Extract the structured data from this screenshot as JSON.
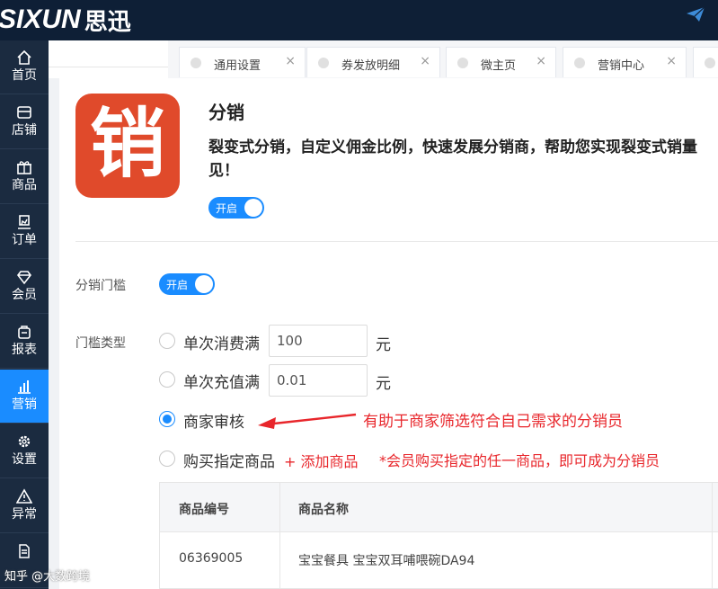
{
  "brand": {
    "en": "SIXUN",
    "cn": "思迅"
  },
  "sidebar": {
    "items": [
      {
        "label": "首页",
        "icon": "home-icon"
      },
      {
        "label": "店铺",
        "icon": "store-icon"
      },
      {
        "label": "商品",
        "icon": "gift-icon"
      },
      {
        "label": "订单",
        "icon": "order-icon"
      },
      {
        "label": "会员",
        "icon": "diamond-icon"
      },
      {
        "label": "报表",
        "icon": "report-icon"
      },
      {
        "label": "营销",
        "icon": "bar-chart-icon",
        "active": true
      },
      {
        "label": "设置",
        "icon": "gear-icon"
      },
      {
        "label": "异常",
        "icon": "warning-icon"
      },
      {
        "label": "",
        "icon": "document-icon"
      }
    ]
  },
  "tabs": [
    {
      "label": "通用设置",
      "close": "×"
    },
    {
      "label": "券发放明细",
      "close": "×"
    },
    {
      "label": "微主页",
      "close": "×"
    },
    {
      "label": "营销中心",
      "close": "×"
    }
  ],
  "feature": {
    "icon_char": "销",
    "title": "分销",
    "description_line1": "裂变式分销，自定义佣金比例，快速发展分销商，帮助您实现裂变式销量",
    "description_line2": "见！",
    "switch_label": "开启"
  },
  "form": {
    "threshold_label": "分销门槛",
    "threshold_switch": "开启",
    "type_label": "门槛类型",
    "options": [
      {
        "label": "单次消费满",
        "value": "100",
        "unit": "元",
        "checked": false
      },
      {
        "label": "单次充值满",
        "value": "0.01",
        "unit": "元",
        "checked": false
      },
      {
        "label": "商家审核",
        "checked": true
      },
      {
        "label": "购买指定商品",
        "checked": false
      }
    ],
    "add_product": "+ 添加商品"
  },
  "annotations": {
    "arrow_note": "有助于商家筛选符合自己需求的分销员",
    "product_note": "*会员购买指定的任一商品，即可成为分销员"
  },
  "table": {
    "headers": [
      "商品编号",
      "商品名称"
    ],
    "rows": [
      [
        "06369005",
        "宝宝餐具 宝宝双耳哺喂碗DA94"
      ]
    ]
  },
  "watermark": "知乎 @大数跨境",
  "colors": {
    "accent": "#1a8cff",
    "annotation": "#e8262b",
    "topbar": "#0e1f36",
    "sidebar": "#1b2b40",
    "icon_bg": "#e04a2b"
  }
}
